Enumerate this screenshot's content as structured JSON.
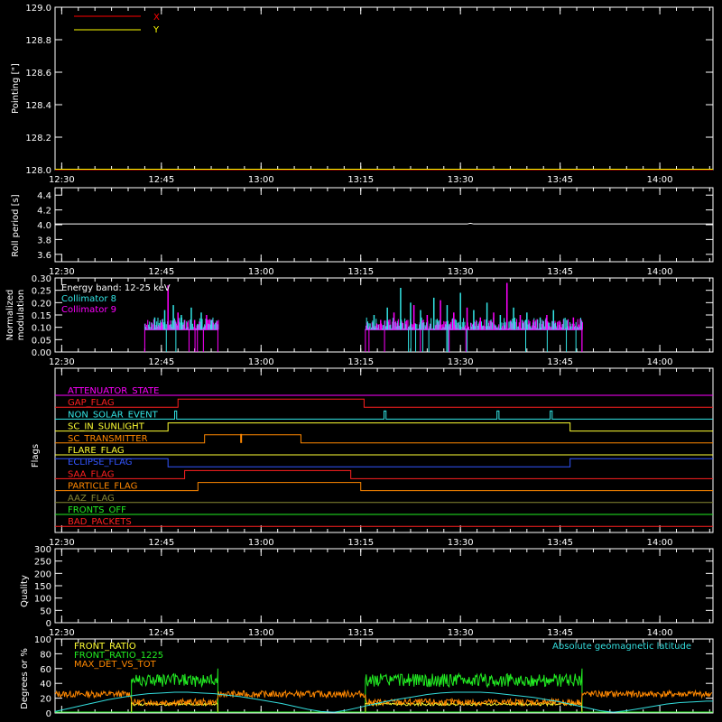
{
  "time_ticks": [
    "12:30",
    "12:45",
    "13:00",
    "13:15",
    "13:30",
    "13:45",
    "14:00"
  ],
  "time_tick_minutes": [
    750,
    765,
    780,
    795,
    810,
    825,
    840
  ],
  "time_range_minutes": [
    749,
    848
  ],
  "colors": {
    "background": "#000000",
    "axis": "#ffffff",
    "x_series": "#ff0000",
    "y_series": "#ffff00",
    "collimator8": "#33e6e6",
    "collimator9": "#ff00ff",
    "front_ratio": "#ffff33",
    "front_ratio_1225": "#22ee22",
    "max_det": "#ff8800",
    "geomag": "#33dddd"
  },
  "chart_data": [
    {
      "id": "pointing",
      "type": "line",
      "ylabel": "Pointing [\"]",
      "ylim": [
        128.0,
        129.0
      ],
      "yticks": [
        "129.0",
        "128.8",
        "128.6",
        "128.4",
        "128.2",
        "128.0"
      ],
      "ytick_values": [
        129.0,
        128.8,
        128.6,
        128.4,
        128.2,
        128.0
      ],
      "legend": [
        {
          "name": "X",
          "color": "#ff0000"
        },
        {
          "name": "Y",
          "color": "#ffff00"
        }
      ],
      "series": [
        {
          "name": "X",
          "x": [
            749,
            848
          ],
          "y": [
            128.0,
            128.0
          ]
        },
        {
          "name": "Y",
          "x": [
            749,
            848
          ],
          "y": [
            128.0,
            128.0
          ]
        }
      ]
    },
    {
      "id": "roll",
      "type": "line",
      "ylabel": "Roll period [s]",
      "ylim": [
        3.5,
        4.5
      ],
      "yticks": [
        "4.4",
        "4.2",
        "4.0",
        "3.8",
        "3.6"
      ],
      "ytick_values": [
        4.4,
        4.2,
        4.0,
        3.8,
        3.6
      ],
      "series": [
        {
          "name": "roll",
          "x": [
            749,
            811,
            811.5,
            812,
            848
          ],
          "y": [
            4.01,
            4.01,
            4.02,
            4.01,
            4.01
          ]
        }
      ]
    },
    {
      "id": "modulation",
      "type": "bar",
      "ylabel": "Normalized modulation",
      "ylim": [
        0,
        0.3
      ],
      "yticks": [
        "0.30",
        "0.25",
        "0.20",
        "0.15",
        "0.10",
        "0.05",
        "0.00"
      ],
      "ytick_values": [
        0.3,
        0.25,
        0.2,
        0.15,
        0.1,
        0.05,
        0.0
      ],
      "annotation": "Energy band: 12-25 keV",
      "legend": [
        {
          "name": "Collimator 8",
          "color": "#33e6e6"
        },
        {
          "name": "Collimator 9",
          "color": "#ff00ff"
        }
      ],
      "segments": [
        [
          762.5,
          773.5
        ],
        [
          795.7,
          828.3
        ]
      ],
      "baseline": 0.09,
      "spikes8": [
        [
          764,
          0.14
        ],
        [
          765.5,
          0.17
        ],
        [
          766.8,
          0.19
        ],
        [
          768,
          0.15
        ],
        [
          769.5,
          0.18
        ],
        [
          771,
          0.16
        ],
        [
          772.5,
          0.13
        ],
        [
          797,
          0.15
        ],
        [
          799,
          0.18
        ],
        [
          801,
          0.26
        ],
        [
          802.5,
          0.2
        ],
        [
          804,
          0.17
        ],
        [
          806,
          0.22
        ],
        [
          808,
          0.19
        ],
        [
          810,
          0.24
        ],
        [
          812,
          0.17
        ],
        [
          814,
          0.2
        ],
        [
          816,
          0.15
        ],
        [
          818,
          0.18
        ],
        [
          820,
          0.16
        ],
        [
          822,
          0.14
        ],
        [
          824,
          0.17
        ],
        [
          826,
          0.13
        ]
      ],
      "spikes9": [
        [
          765,
          0.12
        ],
        [
          766,
          0.27
        ],
        [
          767.5,
          0.16
        ],
        [
          770,
          0.13
        ],
        [
          771.8,
          0.15
        ],
        [
          798,
          0.13
        ],
        [
          800,
          0.16
        ],
        [
          803,
          0.19
        ],
        [
          805,
          0.15
        ],
        [
          807,
          0.21
        ],
        [
          809,
          0.16
        ],
        [
          811,
          0.18
        ],
        [
          813,
          0.14
        ],
        [
          815,
          0.16
        ],
        [
          817,
          0.28
        ],
        [
          819,
          0.15
        ],
        [
          821,
          0.13
        ],
        [
          823,
          0.15
        ],
        [
          825,
          0.12
        ],
        [
          827,
          0.14
        ]
      ]
    },
    {
      "id": "flags",
      "type": "line",
      "ylabel": "Flags",
      "rows": [
        {
          "label": "ATTENUATOR_STATE",
          "color": "#ff00ff",
          "lowY": 0,
          "highY": 0,
          "steps": []
        },
        {
          "label": "GAP_FLAG",
          "color": "#ff2020",
          "steps": [
            [
              749,
              0
            ],
            [
              767.5,
              0
            ],
            [
              767.5,
              1
            ],
            [
              795.5,
              1
            ],
            [
              795.5,
              0
            ],
            [
              848,
              0
            ]
          ]
        },
        {
          "label": "NON_SOLAR_EVENT",
          "color": "#33e6e6",
          "steps": [
            [
              749,
              0
            ],
            [
              767,
              0
            ],
            [
              767,
              1
            ],
            [
              767.3,
              1
            ],
            [
              767.3,
              0
            ],
            [
              798.5,
              0
            ],
            [
              798.5,
              1
            ],
            [
              798.8,
              1
            ],
            [
              798.8,
              0
            ],
            [
              815.5,
              0
            ],
            [
              815.5,
              1
            ],
            [
              815.8,
              1
            ],
            [
              815.8,
              0
            ],
            [
              823.5,
              0
            ],
            [
              823.5,
              1
            ],
            [
              823.8,
              1
            ],
            [
              823.8,
              0
            ],
            [
              848,
              0
            ]
          ]
        },
        {
          "label": "SC_IN_SUNLIGHT",
          "color": "#ffff33",
          "steps": [
            [
              749,
              0
            ],
            [
              766,
              0
            ],
            [
              766,
              1
            ],
            [
              826.5,
              1
            ],
            [
              826.5,
              0
            ],
            [
              848,
              0
            ]
          ]
        },
        {
          "label": "SC_TRANSMITTER",
          "color": "#ff8800",
          "steps": [
            [
              749,
              0
            ],
            [
              771.5,
              0
            ],
            [
              771.5,
              1
            ],
            [
              786,
              1
            ],
            [
              786,
              0
            ],
            [
              848,
              0
            ]
          ]
        },
        {
          "label": "FLARE_FLAG",
          "color": "#ffff33",
          "steps": [
            [
              749,
              0
            ],
            [
              848,
              0
            ]
          ]
        },
        {
          "label": "ECLIPSE_FLAG",
          "color": "#3355ff",
          "steps": [
            [
              749,
              1
            ],
            [
              766,
              1
            ],
            [
              766,
              0
            ],
            [
              826.5,
              0
            ],
            [
              826.5,
              1
            ],
            [
              848,
              1
            ]
          ]
        },
        {
          "label": "SAA_FLAG",
          "color": "#ff2020",
          "steps": [
            [
              749,
              0
            ],
            [
              768.5,
              0
            ],
            [
              768.5,
              1
            ],
            [
              793.5,
              1
            ],
            [
              793.5,
              0
            ],
            [
              848,
              0
            ]
          ]
        },
        {
          "label": "PARTICLE_FLAG",
          "color": "#ff8800",
          "steps": [
            [
              749,
              0
            ],
            [
              770.5,
              0
            ],
            [
              770.5,
              1
            ],
            [
              795,
              1
            ],
            [
              795,
              0
            ],
            [
              848,
              0
            ]
          ]
        },
        {
          "label": "AAZ_FLAG",
          "color": "#888833",
          "steps": [
            [
              749,
              0
            ],
            [
              848,
              0
            ]
          ]
        },
        {
          "label": "FRONTS_OFF",
          "color": "#22ee22",
          "steps": [
            [
              749,
              0
            ],
            [
              848,
              0
            ]
          ]
        },
        {
          "label": "BAD_PACKETS",
          "color": "#ff2020",
          "steps": [
            [
              749,
              0
            ],
            [
              848,
              0
            ]
          ]
        }
      ]
    },
    {
      "id": "quality",
      "type": "line",
      "ylabel": "Quality",
      "ylim": [
        0,
        300
      ],
      "yticks": [
        "300",
        "250",
        "200",
        "150",
        "100",
        "50",
        "0"
      ],
      "ytick_values": [
        300,
        250,
        200,
        150,
        100,
        50,
        0
      ],
      "series": []
    },
    {
      "id": "ratios",
      "type": "line",
      "ylabel": "Degrees or %",
      "ylim": [
        0,
        100
      ],
      "yticks": [
        "100",
        "80",
        "60",
        "40",
        "20",
        "0"
      ],
      "ytick_values": [
        100,
        80,
        60,
        40,
        20,
        0
      ],
      "legend": [
        {
          "name": "FRONT_RATIO",
          "color": "#ffff33"
        },
        {
          "name": "FRONT_RATIO_1225",
          "color": "#22ee22"
        },
        {
          "name": "MAX_DET_VS_TOT",
          "color": "#ff8800"
        }
      ],
      "right_annotation": "Absolute geomagnetic latitude",
      "segments": [
        [
          760.5,
          773.5
        ],
        [
          795.7,
          828.3
        ]
      ],
      "front_ratio_level": 12,
      "front_ratio_1225_level": 40,
      "max_det_level": 20,
      "geomag": {
        "x": [
          749,
          751,
          753,
          755,
          757,
          759,
          761,
          763,
          765,
          767,
          769,
          771,
          773,
          775,
          777,
          779,
          781,
          783,
          785,
          787,
          789,
          791,
          793,
          795,
          797,
          799,
          801,
          803,
          805,
          807,
          809,
          811,
          813,
          815,
          817,
          819,
          821,
          823,
          825,
          827,
          829,
          831,
          833,
          835,
          837,
          839,
          841,
          843,
          845,
          847,
          848
        ],
        "y": [
          2,
          6,
          10,
          14,
          18,
          21,
          24,
          26,
          27,
          28,
          28,
          27,
          26,
          24,
          22,
          19,
          16,
          13,
          9,
          5,
          2,
          1,
          4,
          8,
          12,
          16,
          19,
          22,
          25,
          27,
          28,
          28,
          28,
          27,
          25,
          23,
          21,
          18,
          15,
          11,
          7,
          3,
          1,
          3,
          6,
          9,
          12,
          14,
          15,
          16,
          16
        ]
      }
    }
  ]
}
